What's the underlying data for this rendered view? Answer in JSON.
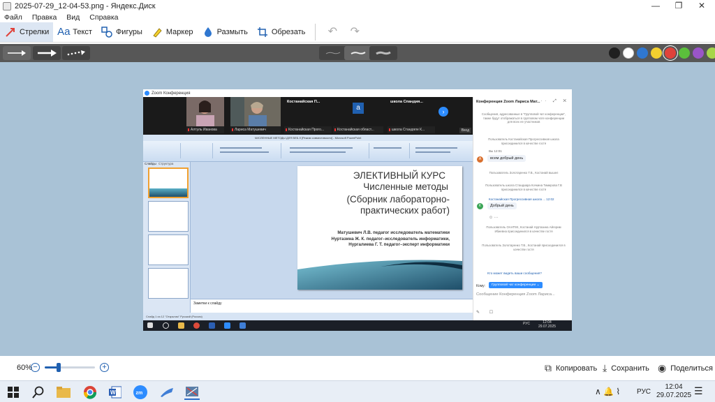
{
  "window": {
    "title": "2025-07-29_12-04-53.png - Яндекс.Диск",
    "minimize_glyph": "—",
    "maximize_glyph": "❐",
    "close_glyph": "✕"
  },
  "menu": {
    "file": "Файл",
    "edit": "Правка",
    "view": "Вид",
    "help": "Справка"
  },
  "tools": {
    "arrows": "Стрелки",
    "text": "Текст",
    "shapes": "Фигуры",
    "marker": "Маркер",
    "blur": "Размыть",
    "crop": "Обрезать",
    "text_icon_glyph": "Aa",
    "undo_glyph": "↶",
    "redo_glyph": "↷"
  },
  "palette": {
    "colors": [
      "#1f1f1f",
      "#ffffff",
      "#2f77d0",
      "#f2cf2f",
      "#e0423a",
      "#5bbf3c",
      "#9a55c8",
      "#a6d64b"
    ],
    "selected": "#e0423a"
  },
  "screenshot": {
    "zoom_app_title": "Zoom Конференция",
    "participants": [
      "Алтуль Иванова",
      "Лариса Матушевич",
      "Костанайская Прого...",
      "Костанайская област...",
      "школа Стандяле К..."
    ],
    "tile_header_1": "Костанайская П...",
    "tile_header_2": "школа Спандия...",
    "avatar_letter": "a",
    "vhod": "Вход",
    "ppt_window_title": "ЧИСЛЕННЫЕ МЕТОДЫ ДЛЯ ВЕБ-9 [Режим совместимости] - Microsoft PowerPoint",
    "ppt_status": "Слайд 1 из 12   \"Открытая\"   Русский (Россия)",
    "slides_tab": "Слайды",
    "outline_tab": "Структура",
    "notes_placeholder": "Заметки к слайду",
    "slide": {
      "line1": "ЭЛЕКТИВНЫЙ КУРС",
      "line2": "Численные методы",
      "line3": "(Сборник лабораторно-практических работ)",
      "authors": [
        "Матушевич Л.В.  педагог исследователь математики",
        "Нуртазина Ж. К. педагог–исследователь информатики,",
        "Нургалиева Г. Т. педагог–эксперт информатики"
      ]
    },
    "chat": {
      "header": "Конференция Zoom Лариса Мат...",
      "header_icons": "··· ⤢ ✕",
      "notice": "Сообщения, адресованные в \"Групповой чат конференции\", также будут отображаться в групповом чате конференции для всех ее участников",
      "join_notice_1": "Пользователь Костанайская Прогрессивная школа присоединился в качестве гостя",
      "msg1_sender": "Вы 12:01",
      "msg1_text": "всем добрый день",
      "msg1_avatar": "А",
      "join_notice_2": "Пользователь Золотаренко Т.В., Костанай вышел",
      "join_notice_3": "Пользователь школа Стандиара Кочкина Тимирова Г.В присоединился в качестве гостя",
      "msg2_sender": "Костанайская Прогрессивная школа ... 12:02",
      "msg2_text": "Добрый день",
      "msg2_avatar": "К",
      "reaction_glyph": "☺ ···",
      "join_notice_4": "Пользователь ОАНТ9Х, Костанай Нуртазина Айгерим Ибиевна присоединился в качестве гостя",
      "join_notice_5": "Пользователь Золотаренко Т.В., Костанай присоединился в качестве гостя",
      "who_sees": "Кто может видеть ваши сообщения?",
      "to_label": "Кому:",
      "to_value": "Групповой чат конференции ⌄",
      "input_placeholder": "Сообщение Конференция Zoom Лариса...",
      "footer_icons": "✎ ☐"
    },
    "tray_lang": "РУС",
    "tray_time": "12:04",
    "tray_date": "29.07.2025"
  },
  "zoom": {
    "percent": "60%",
    "level_fraction": 0.28,
    "minus_glyph": "−",
    "plus_glyph": "+"
  },
  "actions": {
    "copy": "Копировать",
    "save": "Сохранить",
    "share": "Поделиться",
    "copy_icon_glyph": "⧉",
    "save_icon_glyph": "⤓",
    "share_icon_glyph": "◉"
  },
  "taskbar": {
    "lang": "РУС",
    "time": "12:04",
    "date": "29.07.2025",
    "tray_icons_glyph": "∧  🔔  ⌇",
    "notification_glyph": "☰"
  }
}
